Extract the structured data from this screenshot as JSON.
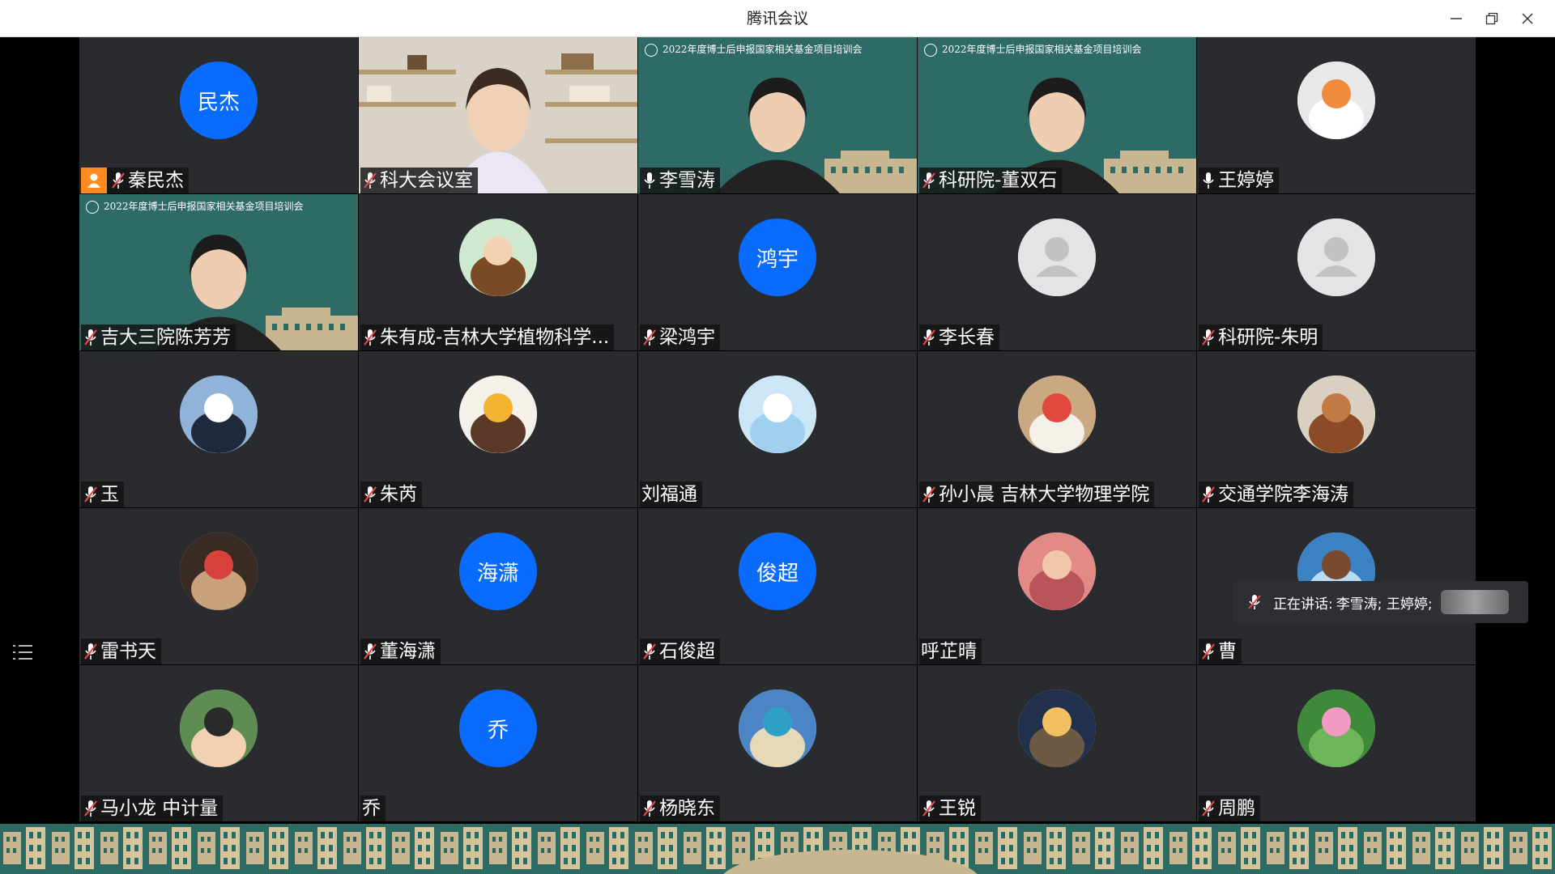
{
  "window": {
    "title": "腾讯会议"
  },
  "participants": [
    {
      "name": "秦民杰",
      "kind": "text",
      "avatar_text": "民杰",
      "mic": "muted",
      "host": true
    },
    {
      "name": "科大会议室",
      "kind": "video",
      "scene": "room",
      "mic": "muted"
    },
    {
      "name": "李雪涛",
      "kind": "video",
      "scene": "banner",
      "mic": "on",
      "speaking": true
    },
    {
      "name": "科研院-董双石",
      "kind": "video",
      "scene": "banner",
      "mic": "muted"
    },
    {
      "name": "王婷婷",
      "kind": "image",
      "avatar_icon": "white-cat-avatar",
      "mic": "on"
    },
    {
      "name": "吉大三院陈芳芳",
      "kind": "video",
      "scene": "banner",
      "mic": "muted"
    },
    {
      "name": "朱有成-吉林大学植物科学...",
      "kind": "image",
      "avatar_icon": "cartoon-boy-avatar",
      "mic": "muted"
    },
    {
      "name": "梁鸿宇",
      "kind": "text",
      "avatar_text": "鸿宇",
      "mic": "muted"
    },
    {
      "name": "李长春",
      "kind": "image",
      "avatar_icon": "default-user-avatar",
      "mic": "muted"
    },
    {
      "name": "科研院-朱明",
      "kind": "image",
      "avatar_icon": "default-user-avatar",
      "mic": "muted"
    },
    {
      "name": "玉",
      "kind": "image",
      "avatar_icon": "girl-cap-avatar",
      "mic": "muted"
    },
    {
      "name": "朱芮",
      "kind": "image",
      "avatar_icon": "girl-flowers-avatar",
      "mic": "muted"
    },
    {
      "name": "刘福通",
      "kind": "image",
      "avatar_icon": "blue-blob-avatar",
      "mic": "none"
    },
    {
      "name": "孙小晨 吉林大学物理学院",
      "kind": "image",
      "avatar_icon": "bunny-toy-avatar",
      "mic": "muted"
    },
    {
      "name": "交通学院李海涛",
      "kind": "image",
      "avatar_icon": "cartoon-dog-avatar",
      "mic": "muted"
    },
    {
      "name": "雷书天",
      "kind": "image",
      "avatar_icon": "meme-photo-avatar",
      "mic": "muted"
    },
    {
      "name": "董海潇",
      "kind": "text",
      "avatar_text": "海潇",
      "mic": "muted"
    },
    {
      "name": "石俊超",
      "kind": "text",
      "avatar_text": "俊超",
      "mic": "muted"
    },
    {
      "name": "呼芷晴",
      "kind": "image",
      "avatar_icon": "pink-frame-avatar",
      "mic": "none"
    },
    {
      "name": "曹",
      "kind": "image",
      "avatar_icon": "seaside-avatar",
      "mic": "muted"
    },
    {
      "name": "马小龙 中计量",
      "kind": "image",
      "avatar_icon": "man-photo-avatar",
      "mic": "muted"
    },
    {
      "name": "乔",
      "kind": "text",
      "avatar_text": "乔",
      "mic": "none"
    },
    {
      "name": "杨晓东",
      "kind": "image",
      "avatar_icon": "hot-spring-avatar",
      "mic": "muted"
    },
    {
      "name": "王锐",
      "kind": "image",
      "avatar_icon": "night-city-avatar",
      "mic": "muted"
    },
    {
      "name": "周鹏",
      "kind": "image",
      "avatar_icon": "lotus-avatar",
      "mic": "muted"
    }
  ],
  "banner_text": "2022年度博士后申报国家相关基金项目培训会",
  "speaking": {
    "prefix": "正在讲话:",
    "names": "李雪涛; 王婷婷;"
  },
  "colors": {
    "text_avatar": "#0a6cff",
    "tile_bg": "#2a2b2e",
    "banner_bg": "#2f6b66",
    "speaking": "#22c55e"
  }
}
